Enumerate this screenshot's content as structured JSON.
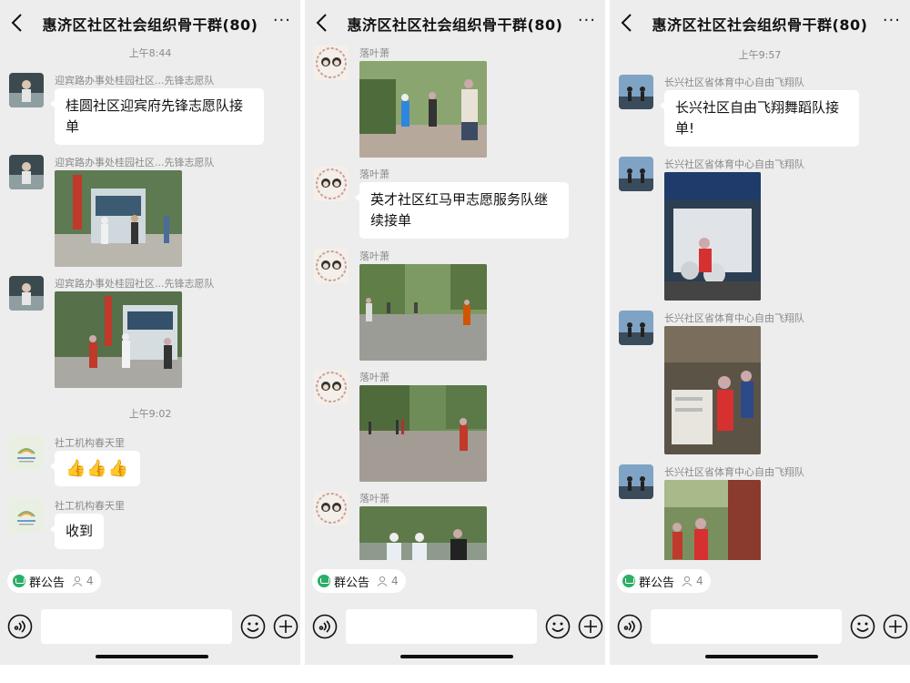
{
  "app": {
    "chat_title": "惠济区社区社会组织骨干群(80)",
    "more_glyph": "···",
    "notice_label": "群公告",
    "member_count": "4"
  },
  "panels": [
    {
      "timestamps": [
        "上午8:44",
        "上午9:02"
      ],
      "messages": [
        {
          "sender": "迎宾路办事处桂园社区...先锋志愿队",
          "text": "桂圆社区迎宾府先锋志愿队接单"
        },
        {
          "sender": "迎宾路办事处桂园社区...先锋志愿队"
        },
        {
          "sender": "迎宾路办事处桂园社区...先锋志愿队"
        },
        {
          "sender": "社工机构春天里",
          "text": "👍👍👍"
        },
        {
          "sender": "社工机构春天里",
          "text": "收到"
        }
      ]
    },
    {
      "messages": [
        {
          "sender": "落叶萧"
        },
        {
          "sender": "落叶萧",
          "text": "英才社区红马甲志愿服务队继续接单"
        },
        {
          "sender": "落叶萧"
        },
        {
          "sender": "落叶萧"
        },
        {
          "sender": "落叶萧"
        }
      ]
    },
    {
      "timestamps": [
        "上午9:57"
      ],
      "messages": [
        {
          "sender": "长兴社区省体育中心自由飞翔队",
          "text": "长兴社区自由飞翔舞蹈队接单!"
        },
        {
          "sender": "长兴社区省体育中心自由飞翔队"
        },
        {
          "sender": "长兴社区省体育中心自由飞翔队"
        },
        {
          "sender": "长兴社区省体育中心自由飞翔队"
        }
      ]
    }
  ],
  "colors": {
    "chat_bg": "#ededed",
    "bubble_bg": "#ffffff",
    "notice_green": "#2bae66"
  }
}
